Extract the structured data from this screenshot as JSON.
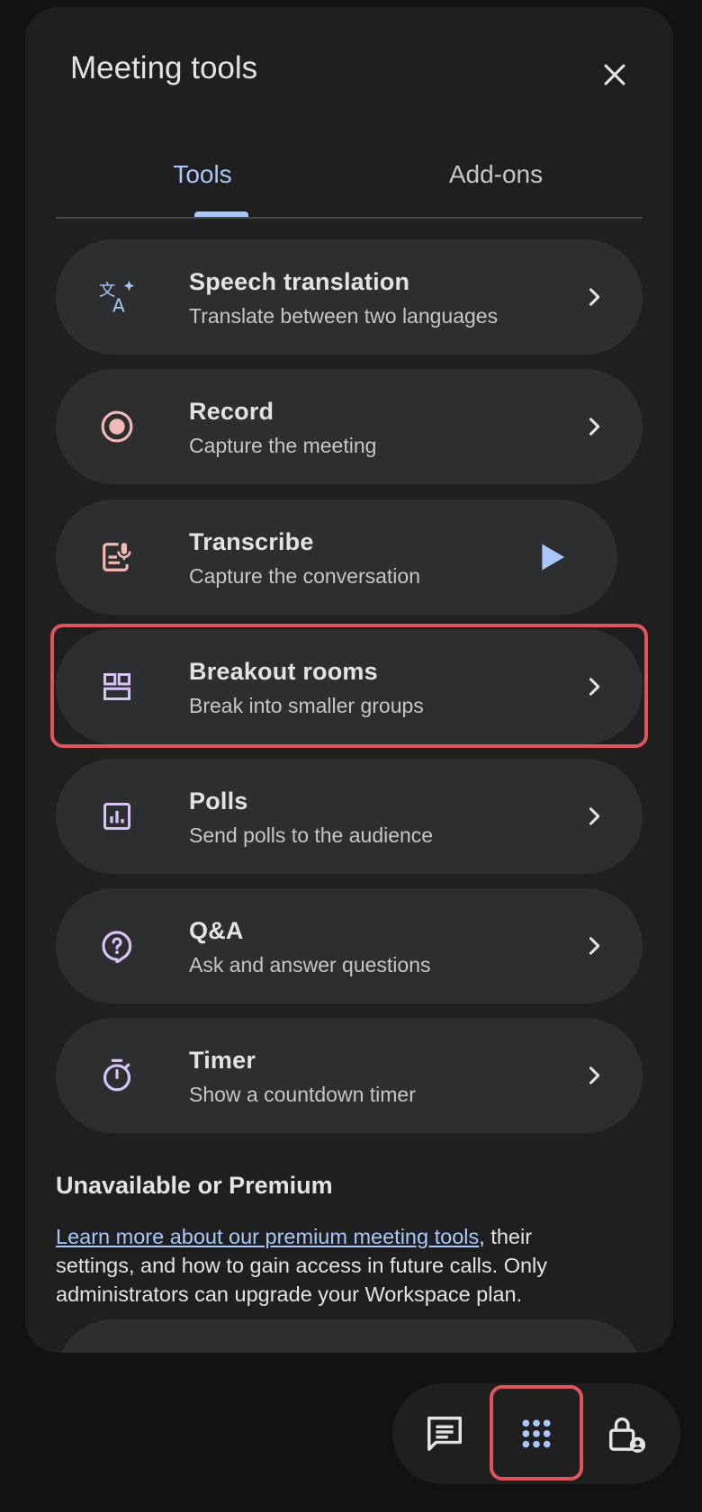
{
  "panel": {
    "title": "Meeting tools",
    "tabs": [
      {
        "label": "Tools",
        "active": true
      },
      {
        "label": "Add-ons",
        "active": false
      }
    ]
  },
  "tools": [
    {
      "title": "Speech translation",
      "subtitle": "Translate between two languages",
      "icon": "translate-icon",
      "icon_color": "#a8c7fa"
    },
    {
      "title": "Record",
      "subtitle": "Capture the meeting",
      "icon": "record-icon",
      "icon_color": "#f2b8b5"
    },
    {
      "title": "Transcribe",
      "subtitle": "Capture the conversation",
      "icon": "transcribe-icon",
      "icon_color": "#f2b8b5"
    },
    {
      "title": "Breakout rooms",
      "subtitle": "Break into smaller groups",
      "icon": "breakout-rooms-icon",
      "icon_color": "#d7c4f7"
    },
    {
      "title": "Polls",
      "subtitle": "Send polls to the audience",
      "icon": "polls-icon",
      "icon_color": "#d7c4f7"
    },
    {
      "title": "Q&A",
      "subtitle": "Ask and answer questions",
      "icon": "qa-icon",
      "icon_color": "#d7c4f7"
    },
    {
      "title": "Timer",
      "subtitle": "Show a countdown timer",
      "icon": "timer-icon",
      "icon_color": "#d7c4f7"
    }
  ],
  "unavailable": {
    "heading": "Unavailable or Premium",
    "link_text": "Learn more about our premium meeting tools",
    "body_text": ", their settings, and how to gain access in future calls. Only administrators can upgrade your Workspace plan."
  },
  "bottom_bar": {
    "buttons": [
      "chat-icon",
      "meeting-tools-icon",
      "host-controls-icon"
    ]
  },
  "colors": {
    "accent": "#a8c7fa",
    "highlight": "#e0545e",
    "panel_bg": "#1f1f1f",
    "item_bg": "#2d2e30"
  }
}
